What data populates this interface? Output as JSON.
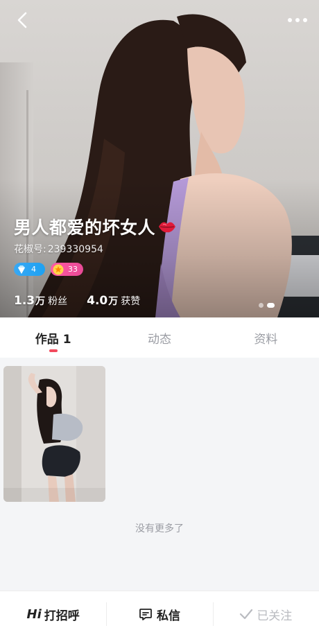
{
  "profile": {
    "nickname": "男人都爱的坏女人",
    "id_label": "花椒号:",
    "id_value": "239330954",
    "badges": [
      {
        "icon": "diamond-icon",
        "value": "4",
        "color": "#1da1f2"
      },
      {
        "icon": "star-icon",
        "value": "33",
        "color": "#e94a96"
      }
    ],
    "followers": {
      "num": "1.3",
      "unit": "万",
      "label": "粉丝"
    },
    "likes": {
      "num": "4.0",
      "unit": "万",
      "label": "获赞"
    },
    "carousel": {
      "total": 2,
      "active": 2
    }
  },
  "tabs": [
    {
      "label": "作品 1",
      "active": true
    },
    {
      "label": "动态",
      "active": false
    },
    {
      "label": "资料",
      "active": false
    }
  ],
  "content": {
    "works_count": 1,
    "no_more_text": "没有更多了"
  },
  "bottom_bar": {
    "greet_icon_text": "Hi",
    "greet_label": "打招呼",
    "message_label": "私信",
    "follow_label": "已关注"
  },
  "colors": {
    "accent": "#f24a5d",
    "muted": "#9a9ca3",
    "followed": "#b9bbc0"
  }
}
